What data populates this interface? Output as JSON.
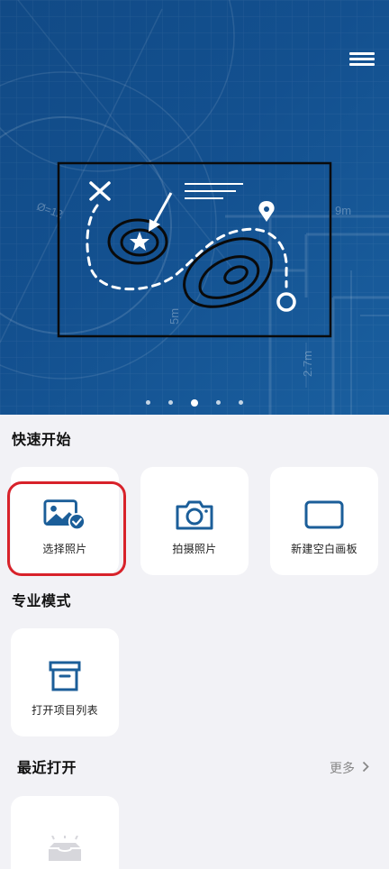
{
  "hero": {
    "menu_icon": "hamburger-menu-icon",
    "carousel": {
      "count": 5,
      "active_index": 2
    },
    "illustration_labels": {
      "dim_top": "9m",
      "dim_left": "5m",
      "dim_right": "2.7m",
      "dim_circle": "Ø=12"
    }
  },
  "quick_start": {
    "title": "快速开始",
    "cards": [
      {
        "label": "选择照片",
        "icon": "photo-select-icon"
      },
      {
        "label": "拍摄照片",
        "icon": "camera-icon"
      },
      {
        "label": "新建空白画板",
        "icon": "blank-canvas-icon"
      }
    ]
  },
  "pro_mode": {
    "title": "专业模式",
    "cards": [
      {
        "label": "打开项目列表",
        "icon": "archive-box-icon"
      }
    ]
  },
  "recent": {
    "title": "最近打开",
    "more_label": "更多",
    "items": [
      {
        "icon": "empty-inbox-icon"
      }
    ]
  },
  "colors": {
    "hero_blue": "#13508f",
    "icon_blue": "#1b5e99",
    "highlight_red": "#d8222a",
    "background": "#f2f2f6"
  }
}
